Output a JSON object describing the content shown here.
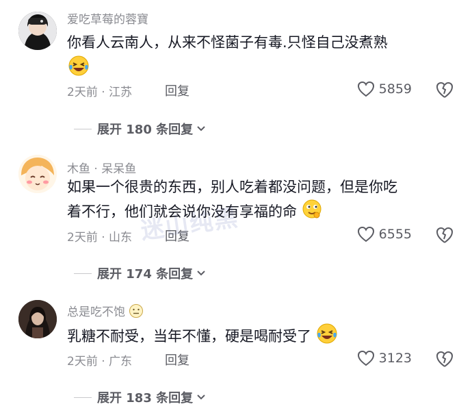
{
  "comments": [
    {
      "username": "爱吃草莓的蓉寶",
      "text": "你看人云南人，从来不怪菌子有毒.只怪自己没煮熟",
      "emoji_after": "laughing-crying-emoji",
      "time_location": "2天前 · 江苏",
      "reply_label": "回复",
      "likes": "5859",
      "expand_label": "展开 180 条回复"
    },
    {
      "username": "木鱼 · 呆呆鱼",
      "text_line1": "如果一个很贵的东西，别人吃着都没问题，但是你吃",
      "text_line2": "着不行，他们就会说你没有享福的命",
      "emoji_after": "thinking-smile-emoji",
      "time_location": "2天前 · 山东",
      "reply_label": "回复",
      "likes": "6555",
      "expand_label": "展开 174 条回复"
    },
    {
      "username": "总是吃不饱",
      "username_emoji": "neutral-face-emoji",
      "text": "乳糖不耐受，当年不懂，硬是喝耐受了",
      "emoji_after": "laughing-crying-emoji",
      "time_location": "2天前 · 广东",
      "reply_label": "回复",
      "likes": "3123",
      "expand_label": "展开 183 条回复"
    }
  ],
  "watermark_text": "迷山纯黑",
  "colors": {
    "text_primary": "#161823",
    "text_secondary": "#8a8b91",
    "action": "#5b5c63"
  }
}
